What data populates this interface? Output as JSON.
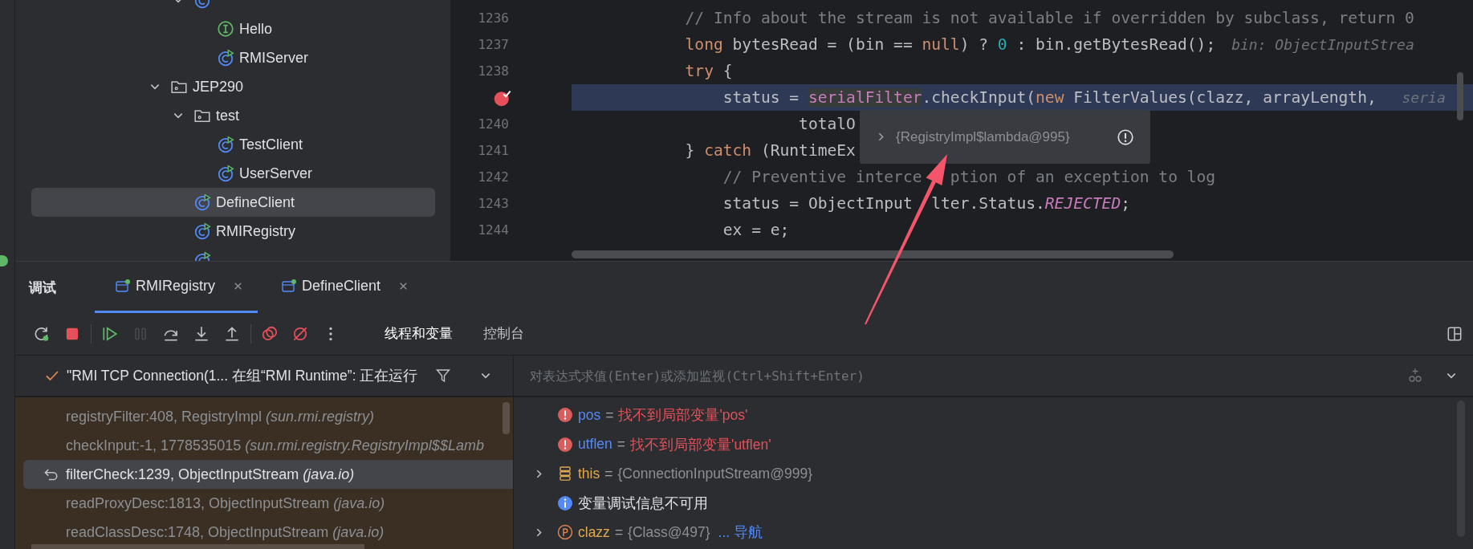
{
  "project_tree": {
    "items": [
      {
        "children": [
          {
            "kind": "class",
            "expanded": true,
            "selected": false,
            "children": [
              {
                "label": "Hello",
                "kind": "interface",
                "selected": false
              },
              {
                "label": "RMIServer",
                "kind": "runnable-class",
                "selected": false
              }
            ]
          }
        ]
      },
      {
        "label": "JEP290",
        "kind": "folder",
        "expanded": true,
        "selected": false,
        "children": [
          {
            "label": "test",
            "kind": "folder",
            "expanded": true,
            "selected": false,
            "children": [
              {
                "label": "TestClient",
                "kind": "runnable-class",
                "selected": false
              },
              {
                "label": "UserServer",
                "kind": "runnable-class",
                "selected": false
              }
            ]
          },
          {
            "label": "DefineClient",
            "kind": "runnable-class",
            "selected": true
          },
          {
            "label": "RMIRegistry",
            "kind": "runnable-class",
            "selected": false
          },
          {
            "kind": "runnable-class",
            "selected": false
          }
        ]
      }
    ]
  },
  "editor": {
    "lines": [
      {
        "number": "1236",
        "current": false,
        "breakpoint": false,
        "tokens": [
          {
            "kind": "comment",
            "text": "            // Info about the stream is not available if overridden by subclass, return 0"
          }
        ]
      },
      {
        "number": "1237",
        "current": false,
        "breakpoint": false,
        "tokens": [
          {
            "kind": "keyword",
            "text": "            long"
          },
          {
            "kind": "plain",
            "text": " bytesRead = (bin == "
          },
          {
            "kind": "keyword",
            "text": "null"
          },
          {
            "kind": "plain",
            "text": ") ? "
          },
          {
            "kind": "number",
            "text": "0"
          },
          {
            "kind": "plain",
            "text": " : bin.getBytesRead();"
          },
          {
            "kind": "hint",
            "text": "bin: ObjectInputStrea"
          }
        ]
      },
      {
        "number": "1238",
        "current": false,
        "breakpoint": false,
        "tokens": [
          {
            "kind": "keyword",
            "text": "            try"
          },
          {
            "kind": "plain",
            "text": " {"
          }
        ]
      },
      {
        "current": true,
        "breakpoint": true,
        "tokens": [
          {
            "kind": "plain",
            "text": "                status = "
          },
          {
            "kind": "field-usage",
            "text": "serialFilter"
          },
          {
            "kind": "plain",
            "text": ".checkInput("
          },
          {
            "kind": "keyword",
            "text": "new"
          },
          {
            "kind": "plain",
            "text": " FilterValues(clazz, arrayLength, "
          },
          {
            "kind": "hint",
            "text": "seria"
          }
        ]
      },
      {
        "number": "1240",
        "current": false,
        "breakpoint": false,
        "tokens": [
          {
            "kind": "plain",
            "text": "                        totalO"
          }
        ]
      },
      {
        "number": "1241",
        "current": false,
        "breakpoint": false,
        "tokens": [
          {
            "kind": "plain",
            "text": "            } "
          },
          {
            "kind": "keyword",
            "text": "catch"
          },
          {
            "kind": "plain",
            "text": " (RuntimeEx"
          }
        ]
      },
      {
        "number": "1242",
        "current": false,
        "breakpoint": false,
        "tokens": [
          {
            "kind": "comment",
            "text": "                // Preventive interce"
          },
          {
            "kind": "covered"
          },
          {
            "kind": "comment",
            "text": "ption of an exception to log"
          }
        ]
      },
      {
        "number": "1243",
        "current": false,
        "breakpoint": false,
        "tokens": [
          {
            "kind": "plain",
            "text": "                status = ObjectInput"
          },
          {
            "kind": "covered"
          },
          {
            "kind": "plain",
            "text": "lter.Status."
          },
          {
            "kind": "constant",
            "text": "REJECTED"
          },
          {
            "kind": "plain",
            "text": ";"
          }
        ]
      },
      {
        "number": "1244",
        "current": false,
        "breakpoint": false,
        "tokens": [
          {
            "kind": "plain",
            "text": "                ex = e;"
          }
        ]
      }
    ],
    "tooltip": {
      "value": "{RegistryImpl$lambda@995}",
      "expanded": false
    }
  },
  "debug": {
    "title": "调试",
    "sessions": [
      {
        "label": "RMIRegistry",
        "selected": true,
        "running": true
      },
      {
        "label": "DefineClient",
        "selected": false,
        "running": true
      }
    ],
    "toolbar": [
      {
        "kind": "rerun",
        "disabled": false
      },
      {
        "kind": "stop",
        "disabled": false
      },
      {
        "kind": "separator"
      },
      {
        "kind": "resume",
        "disabled": false
      },
      {
        "kind": "pause",
        "disabled": true
      },
      {
        "kind": "step-over",
        "disabled": false
      },
      {
        "kind": "step-into",
        "disabled": false
      },
      {
        "kind": "step-out",
        "disabled": false
      },
      {
        "kind": "separator"
      },
      {
        "kind": "breakpoints",
        "disabled": false
      },
      {
        "kind": "mute",
        "disabled": false
      },
      {
        "kind": "more",
        "disabled": false
      }
    ],
    "view_tabs": [
      {
        "label": "线程和变量",
        "selected": true
      },
      {
        "label": "控制台",
        "selected": false
      }
    ],
    "thread": {
      "label": "\"RMI TCP Connection(1... 在组“RMI Runtime”: 正在运行"
    },
    "frames": [
      {
        "method": "registryFilter:408, RegistryImpl",
        "package": "(sun.rmi.registry)",
        "selected": false
      },
      {
        "method": "checkInput:-1, 1778535015",
        "package": "(sun.rmi.registry.RegistryImpl$$Lamb",
        "selected": false
      },
      {
        "method": "filterCheck:1239, ObjectInputStream",
        "package": "(java.io)",
        "selected": true
      },
      {
        "method": "readProxyDesc:1813, ObjectInputStream",
        "package": "(java.io)",
        "selected": false
      },
      {
        "method": "readClassDesc:1748, ObjectInputStream",
        "package": "(java.io)",
        "selected": false
      }
    ],
    "expression": {
      "placeholder": "对表达式求值(Enter)或添加监视(Ctrl+Shift+Enter)"
    },
    "variables": [
      {
        "kind": "error",
        "name": "pos",
        "operator": "=",
        "value": "找不到局部变量'pos'"
      },
      {
        "kind": "error",
        "name": "utflen",
        "operator": "=",
        "value": "找不到局部变量'utflen'"
      },
      {
        "kind": "object",
        "name": "this",
        "operator": "=",
        "value": "{ConnectionInputStream@999}",
        "expanded": false
      },
      {
        "kind": "info",
        "message": "变量调试信息不可用"
      },
      {
        "kind": "parameter",
        "name": "clazz",
        "operator": "=",
        "value": "{Class@497}",
        "link": "... 导航",
        "expanded": false
      }
    ]
  }
}
